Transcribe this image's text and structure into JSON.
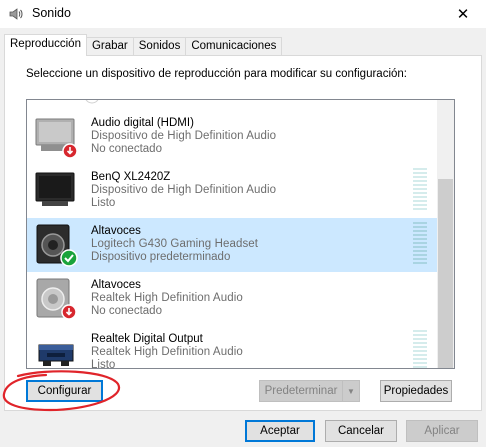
{
  "window": {
    "title": "Sonido",
    "close_glyph": "✕"
  },
  "tabs": [
    {
      "label": "Reproducción",
      "active": true
    },
    {
      "label": "Grabar"
    },
    {
      "label": "Sonidos"
    },
    {
      "label": "Comunicaciones"
    }
  ],
  "instruction": "Seleccione un dispositivo de reproducción para modificar su configuración:",
  "devices": [
    {
      "name": "Audio digital (HDMI)",
      "description": "Dispositivo de High Definition Audio",
      "status": "No conectado",
      "icon": "monitor-disconnected-icon"
    },
    {
      "name": "BenQ XL2420Z",
      "description": "Dispositivo de High Definition Audio",
      "status": "Listo",
      "icon": "monitor-icon"
    },
    {
      "name": "Altavoces",
      "description": "Logitech G430 Gaming Headset",
      "status": "Dispositivo predeterminado",
      "icon": "speaker-default-icon",
      "selected": true
    },
    {
      "name": "Altavoces",
      "description": "Realtek High Definition Audio",
      "status": "No conectado",
      "icon": "speaker-disconnected-icon"
    },
    {
      "name": "Realtek Digital Output",
      "description": "Realtek High Definition Audio",
      "status": "Listo",
      "icon": "digital-output-icon"
    }
  ],
  "buttons": {
    "configure": "Configurar",
    "set_default": "Predeterminar",
    "properties": "Propiedades",
    "accept": "Aceptar",
    "cancel": "Cancelar",
    "apply": "Aplicar"
  },
  "colors": {
    "selection": "#cce8ff",
    "accent": "#0078d7",
    "annotation": "#e0242a",
    "disconnected_badge": "#d7272e",
    "default_badge": "#1aa33b"
  }
}
